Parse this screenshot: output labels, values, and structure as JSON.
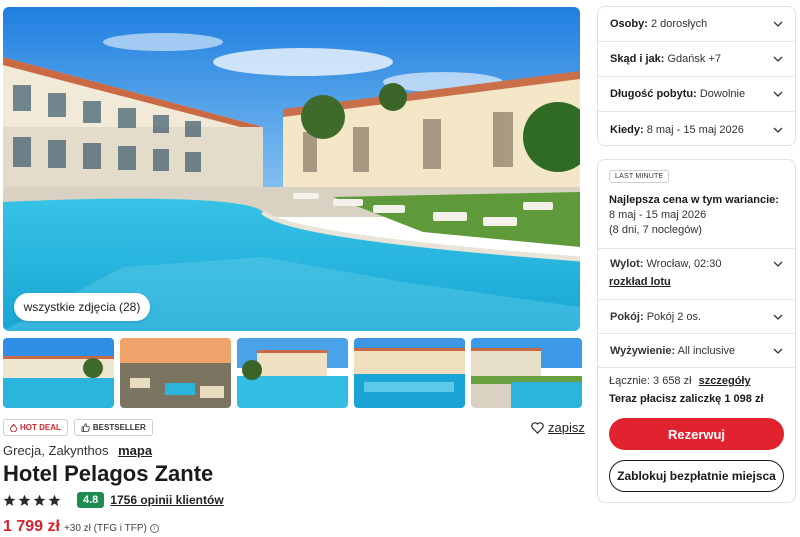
{
  "gallery": {
    "all_photos_label": "wszystkie zdjęcia (28)"
  },
  "badges": {
    "hot_deal": "HOT DEAL",
    "bestseller": "BESTSELLER"
  },
  "save_label": "zapisz",
  "location": {
    "text": "Grecja, Zakynthos",
    "map_link": "mapa"
  },
  "hotel": {
    "name": "Hotel Pelagos Zante",
    "stars": 4,
    "score": "4.8",
    "reviews": "1756 opinii klientów"
  },
  "price": {
    "main": "1 799 zł",
    "extra": "+30 zł (TFG i TFP)"
  },
  "filters": [
    {
      "label": "Osoby:",
      "value": "2 dorosłych"
    },
    {
      "label": "Skąd i jak:",
      "value": "Gdańsk +7"
    },
    {
      "label": "Długość pobytu:",
      "value": "Dowolnie"
    },
    {
      "label": "Kiedy:",
      "value": "8 maj - 15 maj 2026"
    }
  ],
  "offer": {
    "badge": "LAST MINUTE",
    "best_price_label": "Najlepsza cena w tym wariancie:",
    "dates": "8 maj - 15 maj 2026",
    "nights": "(8 dni, 7 noclegów)",
    "flight_label": "Wylot:",
    "flight_value": "Wrocław, 02:30",
    "schedule_link": "rozkład lotu",
    "room_label": "Pokój:",
    "room_value": "Pokój 2 os.",
    "board_label": "Wyżywienie:",
    "board_value": "All inclusive",
    "total_label": "Łącznie: 3 658 zł",
    "details_link": "szczegóły",
    "deposit": "Teraz płacisz zaliczkę 1 098 zł",
    "reserve_button": "Rezerwuj",
    "block_button": "Zablokuj bezpłatnie miejsca"
  },
  "colors": {
    "accent_red": "#e0232f",
    "score_green": "#1e8c4e",
    "pool_blue": "#2bb4dc",
    "sky_blue": "#2f8fe6"
  },
  "icons": [
    "fire-icon",
    "thumb-up-icon",
    "heart-icon",
    "star-icon",
    "chevron-down-icon",
    "info-icon"
  ]
}
